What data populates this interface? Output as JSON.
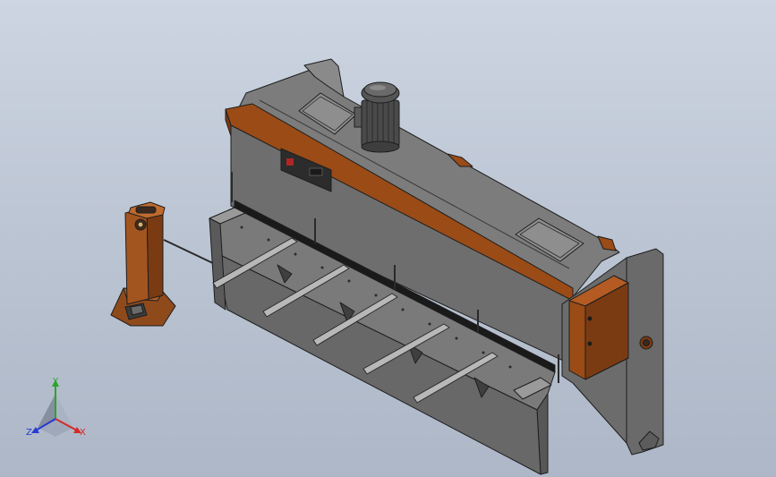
{
  "viewport": {
    "background_top": "#cdd5e2",
    "background_bottom": "#adb7c7"
  },
  "model": {
    "machine_body_color": "#6b6b6b",
    "machine_top_color": "#7c7c7c",
    "trim_color": "#9a4b16",
    "edge_color": "#1e1e1e"
  },
  "triad": {
    "x_label": "X",
    "y_label": "Y",
    "z_label": "Z",
    "x_color": "#d42a2a",
    "y_color": "#2aa52a",
    "z_color": "#2a3ad4"
  }
}
